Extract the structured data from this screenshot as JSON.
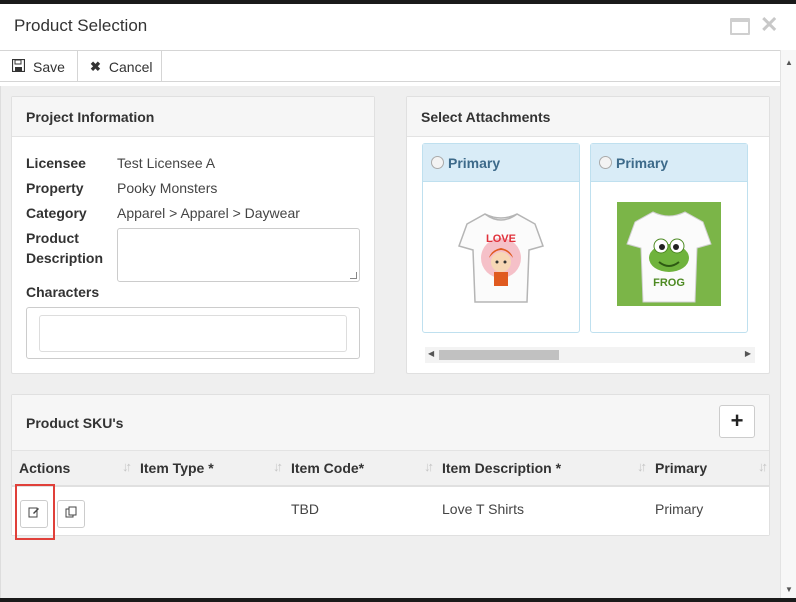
{
  "window": {
    "title": "Product Selection"
  },
  "toolbar": {
    "save_label": "Save",
    "cancel_label": "Cancel"
  },
  "project": {
    "heading": "Project Information",
    "licensee_label": "Licensee",
    "licensee_value": "Test Licensee A",
    "property_label": "Property",
    "property_value": "Pooky Monsters",
    "category_label": "Category",
    "category_value": "Apparel > Apparel > Daywear",
    "description_label_1": "Product",
    "description_label_2": "Description",
    "characters_label": "Characters"
  },
  "attachments": {
    "heading": "Select Attachments",
    "items": [
      {
        "label": "Primary",
        "image_text": "LOVE"
      },
      {
        "label": "Primary",
        "image_text": "FROG"
      }
    ]
  },
  "skus": {
    "heading": "Product SKU's",
    "add_label": "+",
    "columns": [
      "Actions",
      "Item Type *",
      "Item Code*",
      "Item Description *",
      "Primary"
    ],
    "rows": [
      {
        "item_type": "",
        "item_code": "TBD",
        "item_description": "Love T Shirts",
        "primary": "Primary"
      }
    ]
  },
  "colors": {
    "attachment_header": "#d9ecf7",
    "attachment_label": "#3d6a8a",
    "highlight": "#e0403a",
    "frog_background": "#7bb548"
  }
}
